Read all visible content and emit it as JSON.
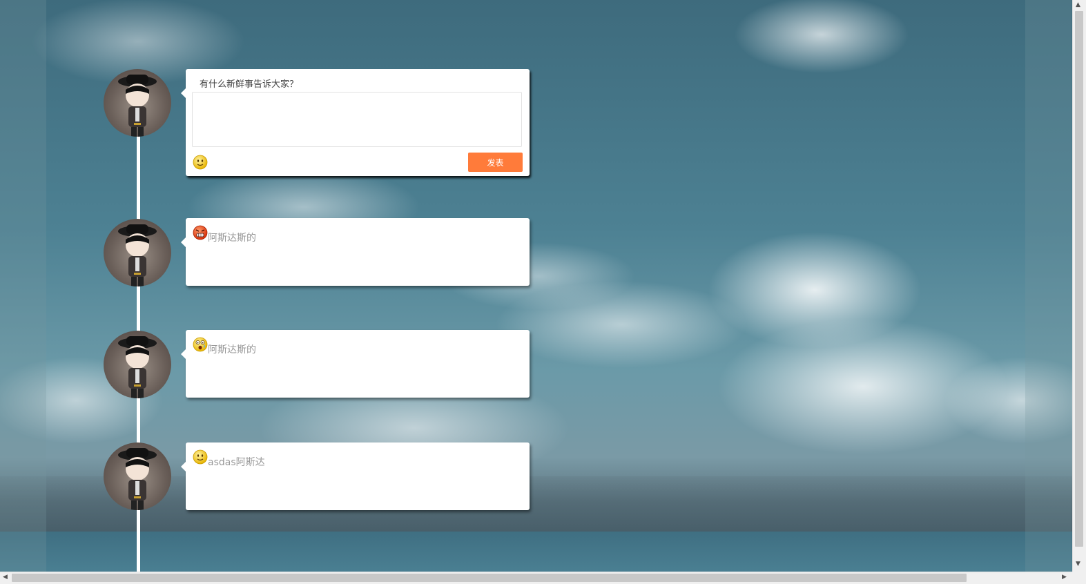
{
  "composer": {
    "title": "有什么新鲜事告诉大家？",
    "textarea_value": "",
    "emoji_icon": "smile-face-icon",
    "publish_label": "发表"
  },
  "posts": [
    {
      "emoji": "angry-face-icon",
      "text": "阿斯达斯的"
    },
    {
      "emoji": "crying-face-icon",
      "text": "阿斯达斯的"
    },
    {
      "emoji": "smile-face-icon",
      "text": "asdas阿斯达"
    }
  ],
  "colors": {
    "accent": "#ff7b3a",
    "timeline": "#ffffff",
    "post_text": "#999999"
  }
}
